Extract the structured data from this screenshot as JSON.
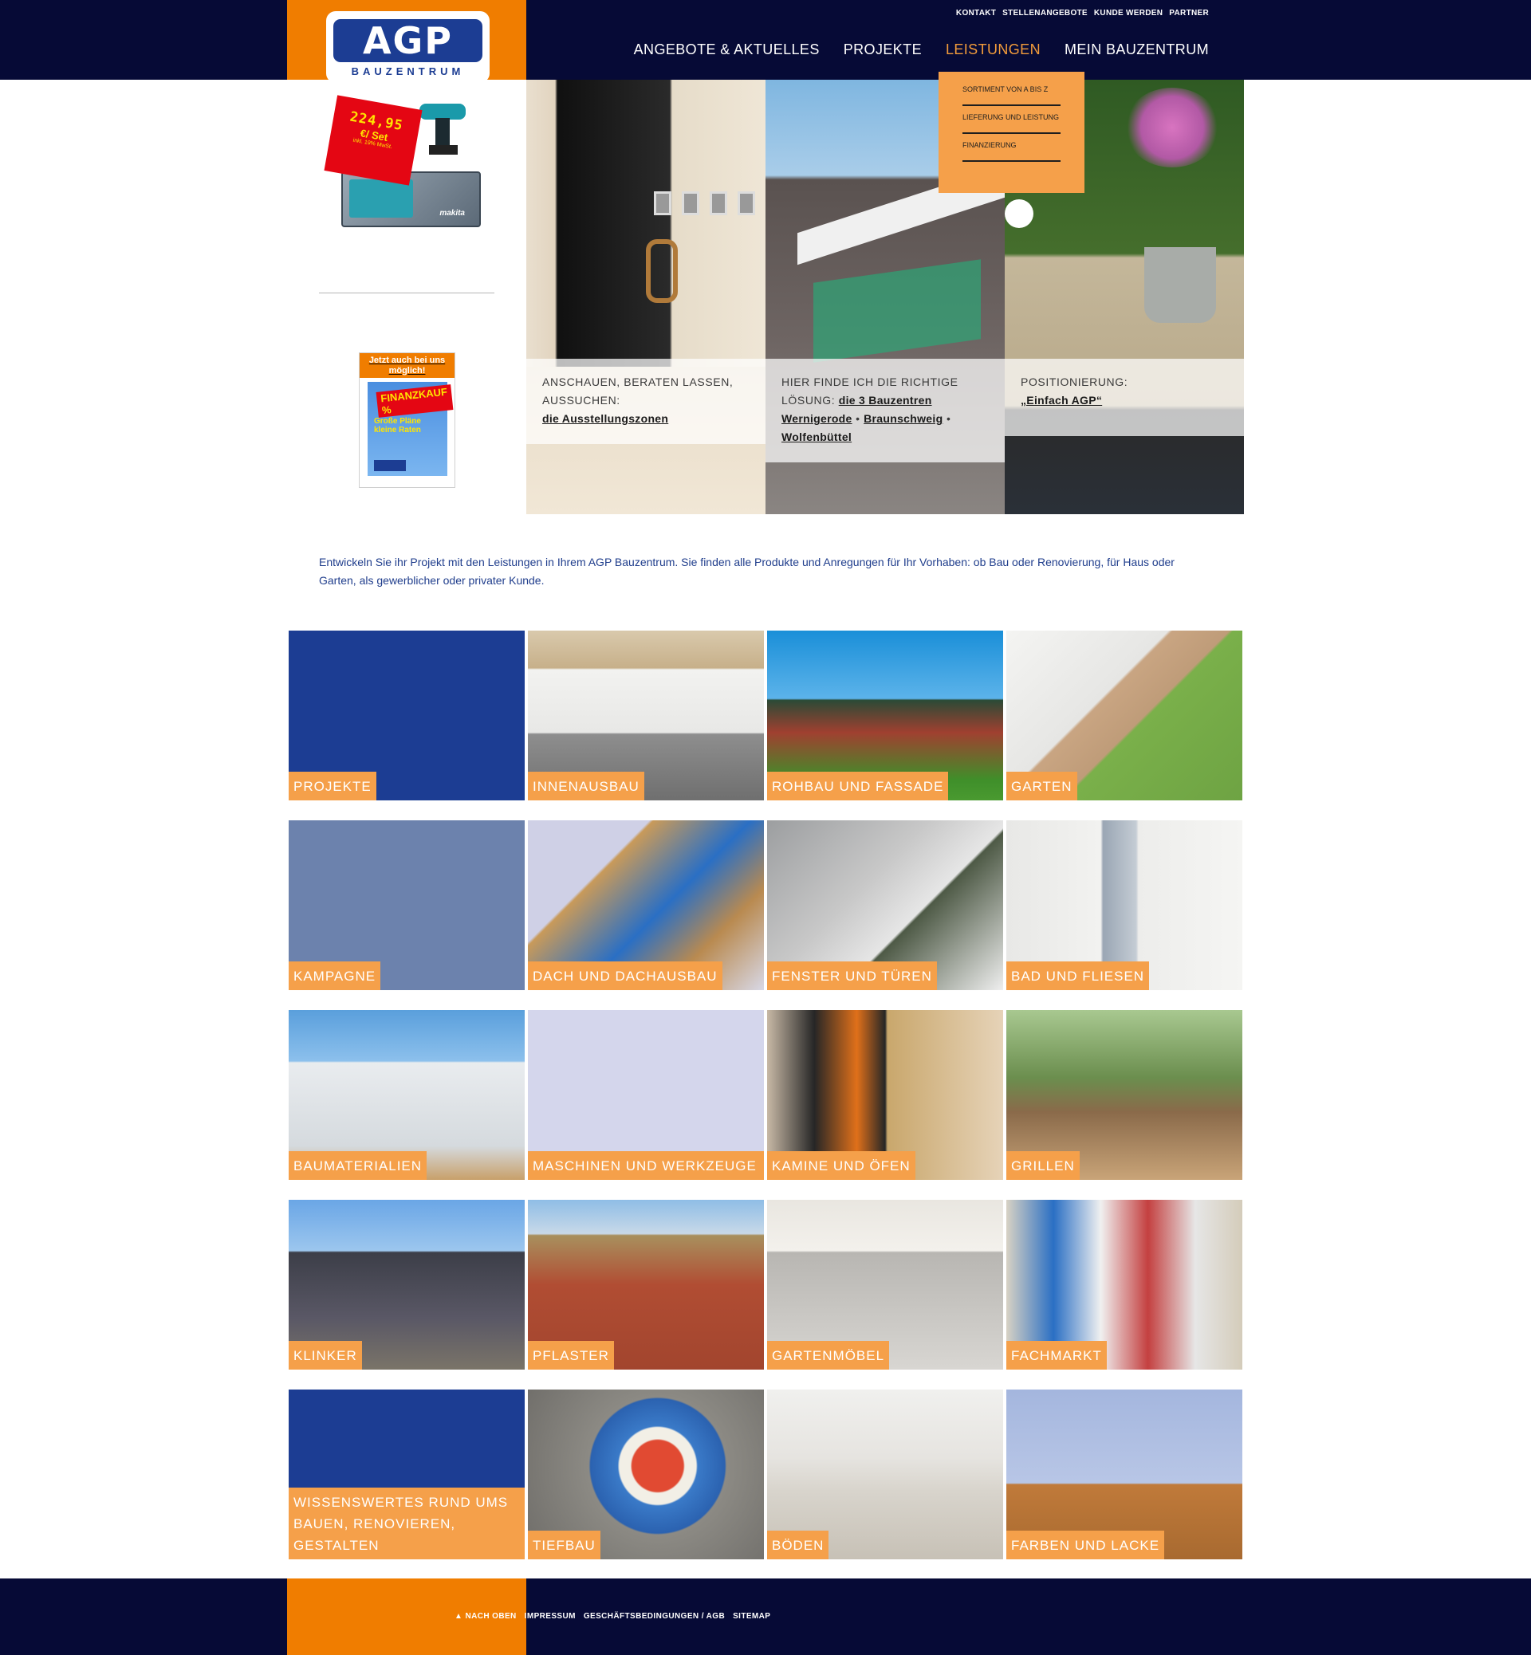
{
  "brand": {
    "logo_text": "AGP",
    "logo_subtitle": "BAUZENTRUM"
  },
  "colors": {
    "navy": "#060a36",
    "orange": "#f07d00",
    "tile_label": "#f5a04a",
    "blue": "#1c3d93",
    "text_blue": "#1f3d8c"
  },
  "utility_nav": [
    "KONTAKT",
    "STELLENANGEBOTE",
    "KUNDE WERDEN",
    "PARTNER"
  ],
  "main_nav": [
    {
      "label": "ANGEBOTE & AKTUELLES",
      "active": false
    },
    {
      "label": "PROJEKTE",
      "active": false
    },
    {
      "label": "LEISTUNGEN",
      "active": true
    },
    {
      "label": "MEIN BAUZENTRUM",
      "active": false
    }
  ],
  "dropdown": [
    "SORTIMENT VON A BIS Z",
    "LIEFERUNG UND LEISTUNG",
    "FINANZIERUNG"
  ],
  "sidebar": {
    "promo_price": "224,95",
    "promo_unit": "€/ Set",
    "promo_tax": "inkl. 19% MwSt.",
    "promo_brand": "makita",
    "finance_heading": "Jetzt auch bei uns möglich!",
    "finance_tag": "FINANZKAUF %",
    "finance_claim": "Große Pläne kleine Raten"
  },
  "hero": [
    {
      "text": "ANSCHAUEN, BERATEN LASSEN, AUSSUCHEN:",
      "link": "die Ausstellungszonen"
    },
    {
      "text": "HIER FINDE ICH DIE RICHTIGE LÖSUNG:",
      "links": [
        "die 3 Bauzentren",
        "Wernigerode",
        "Braunschweig",
        "Wolfenbüttel"
      ],
      "sep": "•"
    },
    {
      "text": "POSITIONIERUNG:",
      "link": "„Einfach AGP“"
    }
  ],
  "intro": "Entwickeln Sie ihr Projekt mit den Leistungen in Ihrem AGP Bauzentrum. Sie finden alle Produkte und Anregungen für Ihr Vorhaben: ob Bau oder Renovierung, für Haus oder Garten, als gewerblicher oder privater Kunde.",
  "tiles": [
    {
      "label": "PROJEKTE",
      "bg": "#1c3d93"
    },
    {
      "label": "INNENAUSBAU"
    },
    {
      "label": "ROHBAU UND FASSADE"
    },
    {
      "label": "GARTEN"
    },
    {
      "label": "KAMPAGNE",
      "bg": "#6c82ad"
    },
    {
      "label": "DACH UND DACHAUSBAU"
    },
    {
      "label": "FENSTER UND TÜREN"
    },
    {
      "label": "BAD UND FLIESEN"
    },
    {
      "label": "BAUMATERIALIEN"
    },
    {
      "label": "MASCHINEN UND WERKZEUGE"
    },
    {
      "label": "KAMINE UND ÖFEN"
    },
    {
      "label": "GRILLEN"
    },
    {
      "label": "KLINKER"
    },
    {
      "label": "PFLASTER"
    },
    {
      "label": "GARTENMÖBEL"
    },
    {
      "label": "FACHMARKT"
    },
    {
      "label": "WISSENSWERTES RUND UMS BAUEN, RENOVIEREN, GESTALTEN",
      "bg": "#1c3d93"
    },
    {
      "label": "TIEFBAU"
    },
    {
      "label": "BÖDEN"
    },
    {
      "label": "FARBEN UND LACKE"
    }
  ],
  "footer": {
    "back_to_top": "NACH OBEN",
    "links": [
      "IMPRESSUM",
      "GESCHÄFTSBEDINGUNGEN / AGB",
      "SITEMAP"
    ]
  }
}
